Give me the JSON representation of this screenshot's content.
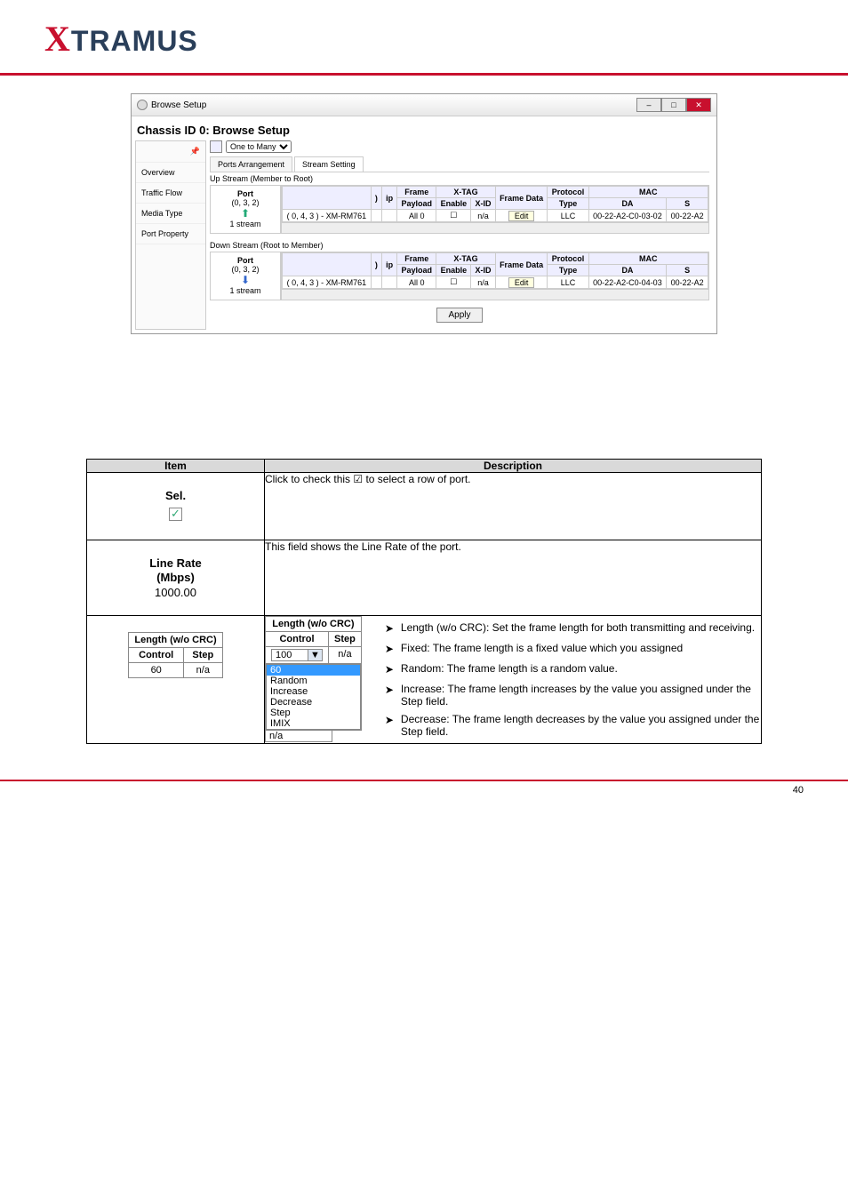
{
  "brand": {
    "x": "X",
    "rest": "TRAMUS"
  },
  "window": {
    "title": "Browse Setup",
    "heading": "Chassis ID 0: Browse Setup",
    "sidebar": [
      "Overview",
      "Traffic Flow",
      "Media Type",
      "Port Property"
    ],
    "topology_dd": "One to Many",
    "tabs": [
      "Ports Arrangement",
      "Stream Setting"
    ],
    "active_tab": 1,
    "up_label": "Up Stream (Member to Root)",
    "down_label": "Down Stream (Root to Member)",
    "port_block_up": {
      "title": "Port",
      "coord": "(0, 3, 2)",
      "stream": "1 stream"
    },
    "port_block_down": {
      "title": "Port",
      "coord": "(0, 3, 2)",
      "stream": "1 stream"
    },
    "grid_headers": {
      "col_paren": ")",
      "col_ip": "ip",
      "frame": "Frame",
      "payload": "Payload",
      "xtag": "X-TAG",
      "enable": "Enable",
      "xid": "X-ID",
      "frame_data": "Frame Data",
      "protocol": "Protocol",
      "type": "Type",
      "mac": "MAC",
      "da": "DA",
      "s": "S"
    },
    "up_row": {
      "device": "( 0, 4, 3 ) - XM-RM761",
      "payload": "All 0",
      "enable": "☐",
      "xid": "n/a",
      "frame_data": "Edit",
      "type": "LLC",
      "da": "00-22-A2-C0-03-02",
      "s2": "00-22-A2"
    },
    "down_row": {
      "device": "( 0, 4, 3 ) - XM-RM761",
      "payload": "All 0",
      "enable": "☐",
      "xid": "n/a",
      "frame_data": "Edit",
      "type": "LLC",
      "da": "00-22-A2-C0-04-03",
      "s2": "00-22-A2"
    },
    "apply": "Apply"
  },
  "desc": {
    "item_header": "Item",
    "desc_header": "Description",
    "sel_label": "Sel.",
    "sel_text": "Click to check this ☑ to select a row of port.",
    "line_rate_head1": "Line Rate",
    "line_rate_head2": "(Mbps)",
    "line_rate_val": "1000.00",
    "line_rate_text": "This field shows the Line Rate of the port.",
    "len_title": "Length (w/o CRC)",
    "len_ctrl": "Control",
    "len_step": "Step",
    "len_val": "60",
    "len_na": "n/a",
    "popup_val": "100",
    "popup_sel": "60",
    "popup_opts": [
      "Random",
      "Increase",
      "Decrease",
      "Step",
      "IMIX"
    ],
    "b1": "Length (w/o CRC): Set the frame length for both transmitting and receiving.",
    "b2": "Fixed: The frame length is a fixed value which you assigned",
    "b3": "Random: The frame length is a random value.",
    "b4": "Increase: The frame length increases by the value you assigned under the Step field.",
    "b5": "Decrease: The frame length decreases by the value you assigned under the Step field.",
    "page_num": "40"
  }
}
